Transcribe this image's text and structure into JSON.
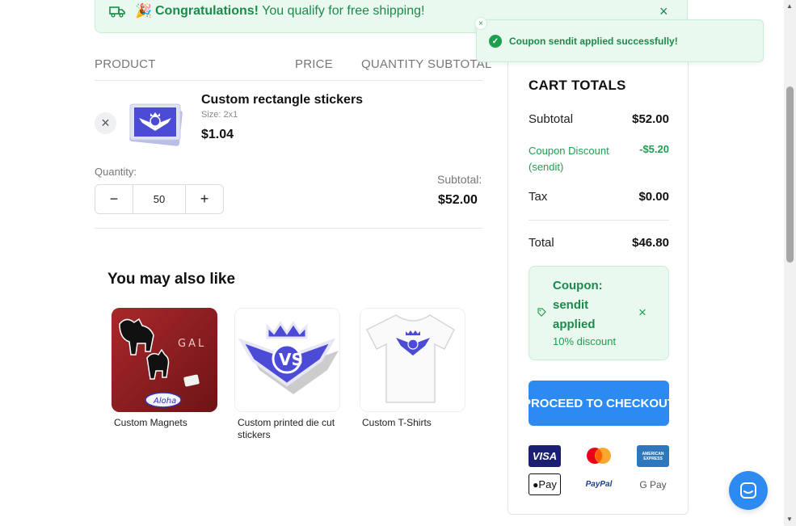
{
  "shipping_banner": {
    "party_emoji": "🎉",
    "bold": "Congratulations!",
    "text": " You qualify for free shipping!"
  },
  "table_header": {
    "product": "PRODUCT",
    "price": "PRICE",
    "quantity": "QUANTITY",
    "subtotal": "SUBTOTAL"
  },
  "cart_item": {
    "name": "Custom rectangle stickers",
    "size": "Size: 2x1",
    "price": "$1.04",
    "quantity_label": "Quantity:",
    "quantity": "50",
    "subtotal_label": "Subtotal:",
    "subtotal": "$52.00"
  },
  "recommendations": {
    "title": "You may also like",
    "items": [
      {
        "name": "Custom Magnets"
      },
      {
        "name": "Custom printed die cut stickers"
      },
      {
        "name": "Custom T-Shirts"
      }
    ]
  },
  "cart_totals": {
    "title": "CART TOTALS",
    "subtotal_label": "Subtotal",
    "subtotal": "$52.00",
    "discount_label": "Coupon Discount (sendit)",
    "discount": "-$5.20",
    "tax_label": "Tax",
    "tax": "$0.00",
    "total_label": "Total",
    "total": "$46.80",
    "coupon_line1": "Coupon:",
    "coupon_line2": "sendit",
    "coupon_line3": "applied",
    "coupon_discount": "10% discount",
    "checkout_label": "PROCEED TO CHECKOUT"
  },
  "payment_methods": {
    "visa": "VISA",
    "apple_pay": "Pay",
    "paypal": "PayPal",
    "gpay": "G Pay",
    "amex": "AMERICAN EXPRESS"
  },
  "toast": {
    "message": "Coupon sendit applied successfully!"
  },
  "icons": {
    "remove": "×",
    "minus": "−",
    "plus": "+",
    "close": "×"
  },
  "colors": {
    "accent_green": "#1e9e4f",
    "accent_blue": "#2d8af0",
    "brand_purple": "#4b4bd6"
  }
}
